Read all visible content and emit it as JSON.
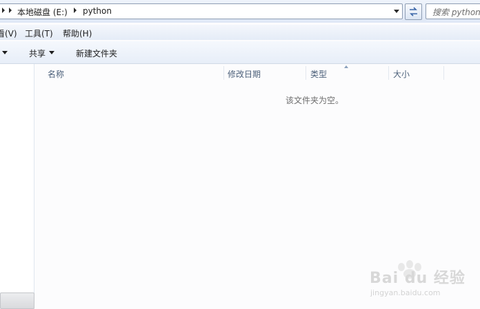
{
  "address_bar": {
    "crumbs": [
      "本地磁盘 (E:)",
      "python"
    ],
    "search_placeholder": "搜索 python"
  },
  "menu": {
    "items": [
      "看(V)",
      "工具(T)",
      "帮助(H)"
    ]
  },
  "command_bar": {
    "share_label": "共享",
    "new_folder_label": "新建文件夹"
  },
  "columns": [
    "名称",
    "修改日期",
    "类型",
    "大小"
  ],
  "empty_message": "该文件夹为空。",
  "watermark": {
    "brand": "Bai du 经验",
    "url": "jingyan.baidu.com"
  }
}
